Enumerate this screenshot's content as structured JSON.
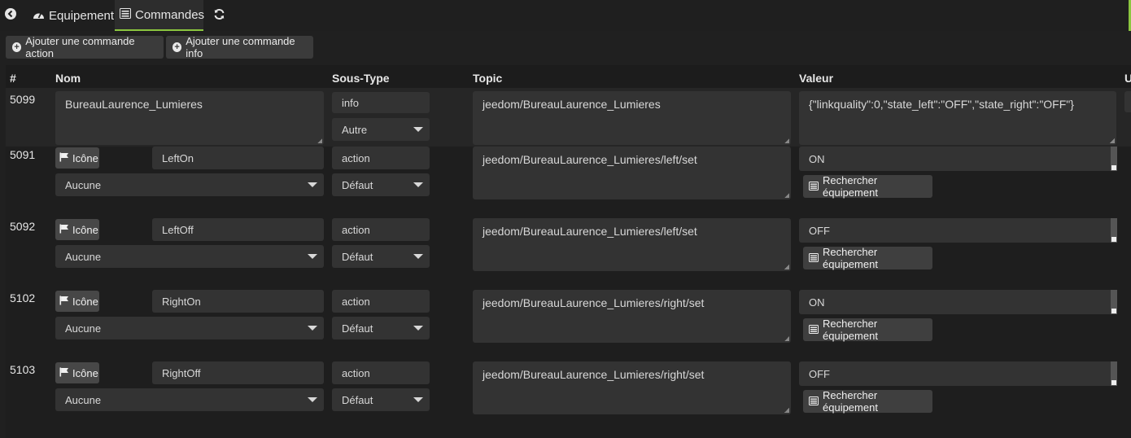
{
  "nav": {
    "back_icon": "arrow-circle-left-icon",
    "tabs": [
      {
        "label": "Equipement",
        "icon": "tachometer-icon"
      },
      {
        "label": "Commandes",
        "icon": "list-icon"
      }
    ],
    "refresh_icon": "refresh-icon"
  },
  "toolbar": {
    "add_action_label": "Ajouter une commande action",
    "add_info_label": "Ajouter une commande info"
  },
  "table": {
    "headers": {
      "id": "#",
      "name": "Nom",
      "subtype": "Sous-Type",
      "topic": "Topic",
      "value": "Valeur",
      "extra": "U"
    },
    "info_row": {
      "id": "5099",
      "name": "BureauLaurence_Lumieres",
      "type": "info",
      "subtype": "Autre",
      "topic": "jeedom/BureauLaurence_Lumieres",
      "value": "{\"linkquality\":0,\"state_left\":\"OFF\",\"state_right\":\"OFF\"}"
    },
    "icon_button_label": "Icône",
    "search_button_label": "Rechercher équipement",
    "action_rows": [
      {
        "id": "5091",
        "name": "LeftOn",
        "generic": "Aucune",
        "type": "action",
        "subtype": "Défaut",
        "topic": "jeedom/BureauLaurence_Lumieres/left/set",
        "value": "ON"
      },
      {
        "id": "5092",
        "name": "LeftOff",
        "generic": "Aucune",
        "type": "action",
        "subtype": "Défaut",
        "topic": "jeedom/BureauLaurence_Lumieres/left/set",
        "value": "OFF"
      },
      {
        "id": "5102",
        "name": "RightOn",
        "generic": "Aucune",
        "type": "action",
        "subtype": "Défaut",
        "topic": "jeedom/BureauLaurence_Lumieres/right/set",
        "value": "ON"
      },
      {
        "id": "5103",
        "name": "RightOff",
        "generic": "Aucune",
        "type": "action",
        "subtype": "Défaut",
        "topic": "jeedom/BureauLaurence_Lumieres/right/set",
        "value": "OFF"
      }
    ]
  },
  "colors": {
    "accent": "#8cc63f",
    "background": "#202020",
    "field": "#333333"
  }
}
